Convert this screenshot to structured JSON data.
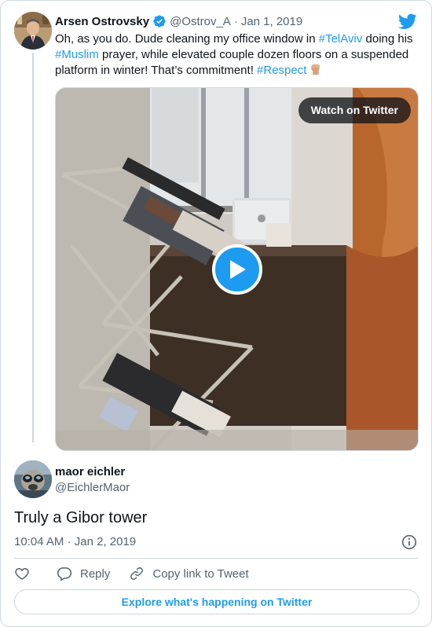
{
  "quoted_tweet": {
    "author_name": "Arsen Ostrovsky",
    "handle": "@Ostrov_A",
    "separator": "·",
    "date": "Jan 1, 2019",
    "text_segments": [
      {
        "text": "Oh, as you do. Dude cleaning my office window in ",
        "type": "plain"
      },
      {
        "text": "#TelAviv",
        "type": "hashtag"
      },
      {
        "text": " doing his ",
        "type": "plain"
      },
      {
        "text": "#Muslim",
        "type": "hashtag"
      },
      {
        "text": " prayer, while elevated couple dozen floors on a suspended platform in winter! That’s commitment! ",
        "type": "plain"
      },
      {
        "text": "#Respect",
        "type": "hashtag"
      }
    ],
    "emoji_icon": "raised-fist-icon",
    "media": {
      "watch_label": "Watch on Twitter",
      "play_icon": "play-icon"
    }
  },
  "reply": {
    "author_name": "maor eichler",
    "handle": "@EichlerMaor",
    "text": "Truly a Gibor tower",
    "time": "10:04 AM",
    "separator": "·",
    "date": "Jan 2, 2019"
  },
  "actions": {
    "like_icon": "heart-icon",
    "reply_label": "Reply",
    "copy_label": "Copy link to Tweet"
  },
  "explore_label": "Explore what's happening on Twitter",
  "colors": {
    "accent": "#1d9bf0",
    "text": "#0f1419",
    "muted": "#536471",
    "border": "#cfd9de"
  }
}
